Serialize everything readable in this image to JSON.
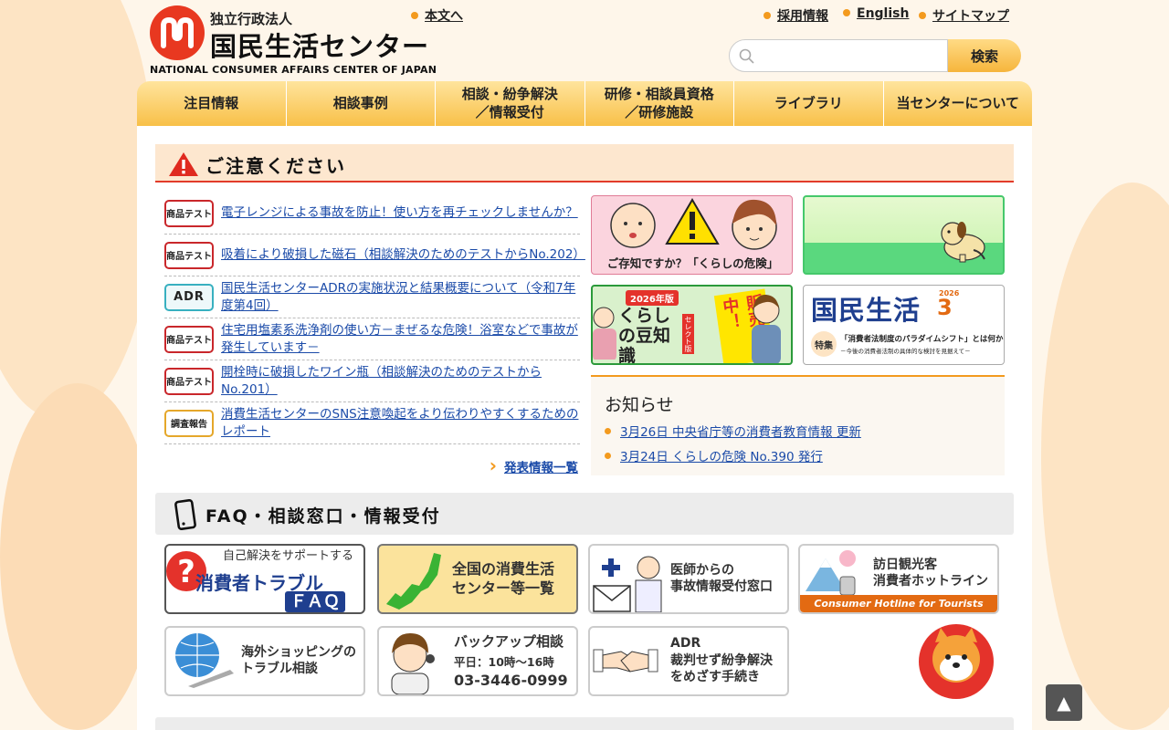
{
  "header": {
    "logo_small": "独立行政法人",
    "logo_big": "国民生活センター",
    "logo_en": "NATIONAL CONSUMER AFFAIRS CENTER OF JAPAN",
    "skip_link": "本文へ",
    "util_links": [
      "採用情報",
      "English",
      "サイトマップ"
    ],
    "search_placeholder": "",
    "search_button": "検索"
  },
  "nav": {
    "items": [
      "注目情報",
      "相談事例",
      "相談・紛争解決\n／情報受付",
      "研修・相談員資格\n／研修施設",
      "ライブラリ",
      "当センターについて"
    ]
  },
  "caution": {
    "title": "ご注意ください",
    "items": [
      {
        "tag": "商品テスト",
        "text": "電子レンジによる事故を防止！使い方を再チェックしませんか？"
      },
      {
        "tag": "商品テスト",
        "text": "吸着により破損した磁石（相談解決のためのテストからNo.202）"
      },
      {
        "tag": "ADR",
        "text": "国民生活センターADRの実施状況と結果概要について（令和7年度第4回）"
      },
      {
        "tag": "商品テスト",
        "text": "住宅用塩素系洗浄剤の使い方－まぜるな危険！浴室などで事故が発生しています－"
      },
      {
        "tag": "商品テスト",
        "text": "開栓時に破損したワイン瓶（相談解決のためのテストからNo.201）"
      },
      {
        "tag": "調査報告",
        "text": "消費生活センターのSNS注意喚起をより伝わりやすくするためのレポート"
      }
    ],
    "more_link": "発表情報一覧"
  },
  "banners": {
    "kurashi_kiken": "ご存知ですか？「くらしの危険」",
    "mame_year": "2026年版",
    "mame_title": "くらしの豆知識",
    "mame_select": "セレクト版",
    "mame_sale": "販売中！",
    "kokumin_title": "国民生活",
    "kokumin_year": "2026",
    "kokumin_issue": "3",
    "kokumin_tokushu": "特集",
    "kokumin_sub": "「消費者法制度のパラダイムシフト」とは何か",
    "kokumin_sub2": "－今後の消費者法制の具体的な検討を見据えて－"
  },
  "notice": {
    "title": "お知らせ",
    "items": [
      "3月26日 中央省庁等の消費者教育情報 更新",
      "3月24日 くらしの危険 No.390 発行"
    ]
  },
  "faq": {
    "title": "FAQ・相談窓口・情報受付",
    "tiles": {
      "faq_top": "自己解決をサポートする",
      "faq_main": "消費者トラブル",
      "faq_sub": "ＦＡＱ",
      "centers": "全国の消費生活\nセンター等一覧",
      "doctors": "医師からの\n事故情報受付窓口",
      "tourists": "訪日観光客\n消費者ホットライン",
      "tourists_en": "Consumer Hotline for Tourists",
      "overseas": "海外ショッピングの\nトラブル相談",
      "backup_title": "バックアップ相談",
      "backup_hours": "平日：10時～16時",
      "backup_tel": "03-3446-0999",
      "adr_title": "ADR",
      "adr_text": "裁判せず紛争解決\nをめざす手続き"
    }
  },
  "totop": "▲",
  "colors": {
    "accent": "#f39a1e",
    "red": "#e83820",
    "link": "#1a4aa8"
  }
}
